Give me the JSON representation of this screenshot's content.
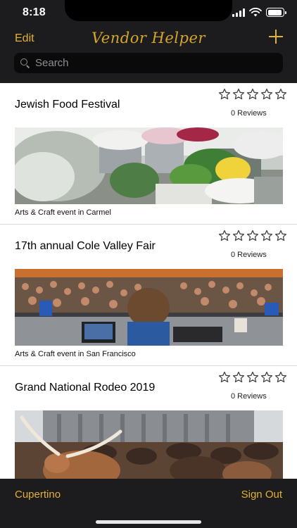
{
  "status_bar": {
    "time": "8:18",
    "battery_level": 0.95
  },
  "nav": {
    "edit_label": "Edit",
    "title": "Vendor Helper",
    "add_icon": "plus-icon"
  },
  "search": {
    "placeholder": "Search"
  },
  "events": [
    {
      "title": "Jewish Food Festival",
      "rating": 0,
      "reviews": "0 Reviews",
      "caption": "Arts & Craft event in Carmel",
      "image": "flower-market-photo"
    },
    {
      "title": "17th annual Cole Valley Fair",
      "rating": 0,
      "reviews": "0 Reviews",
      "caption": "Arts & Craft event in San Francisco",
      "image": "dj-crowd-photo"
    },
    {
      "title": "Grand National Rodeo 2019",
      "rating": 0,
      "reviews": "0 Reviews",
      "caption": "",
      "image": "cattle-rodeo-photo"
    }
  ],
  "bottom_bar": {
    "location_label": "Cupertino",
    "sign_out_label": "Sign Out"
  },
  "colors": {
    "accent": "#e5b22e",
    "bar_bg": "#1c1c1e"
  }
}
